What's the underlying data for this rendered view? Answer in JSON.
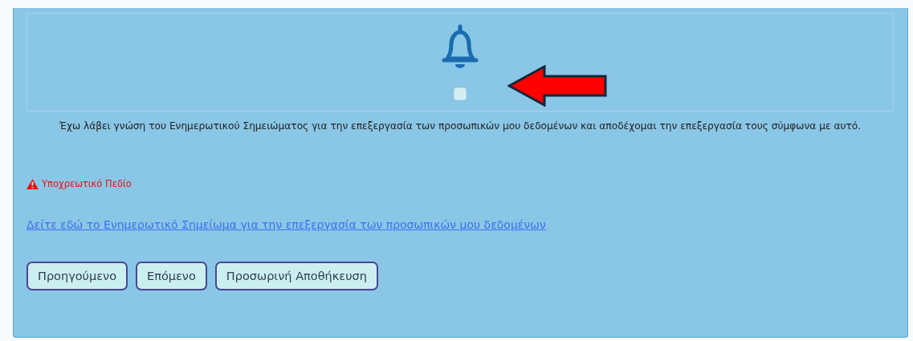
{
  "consent": {
    "checked": false,
    "statement": "Έχω λάβει γνώση του Ενημερωτικού Σημειώματος για την επεξεργασία των προσωπικών μου δεδομένων και αποδέχομαι την επεξεργασία τους σύμφωνα με αυτό."
  },
  "error": "Υποχρεωτικό Πεδίο",
  "link": "Δείτε εδώ το Ενημερωτικό Σημείωμα για την επεξεργασία των προσωπικών μου δεδομένων",
  "buttons": [
    "Προηγούμενο",
    "Επόμενο",
    "Προσωρινή Αποθήκευση"
  ]
}
